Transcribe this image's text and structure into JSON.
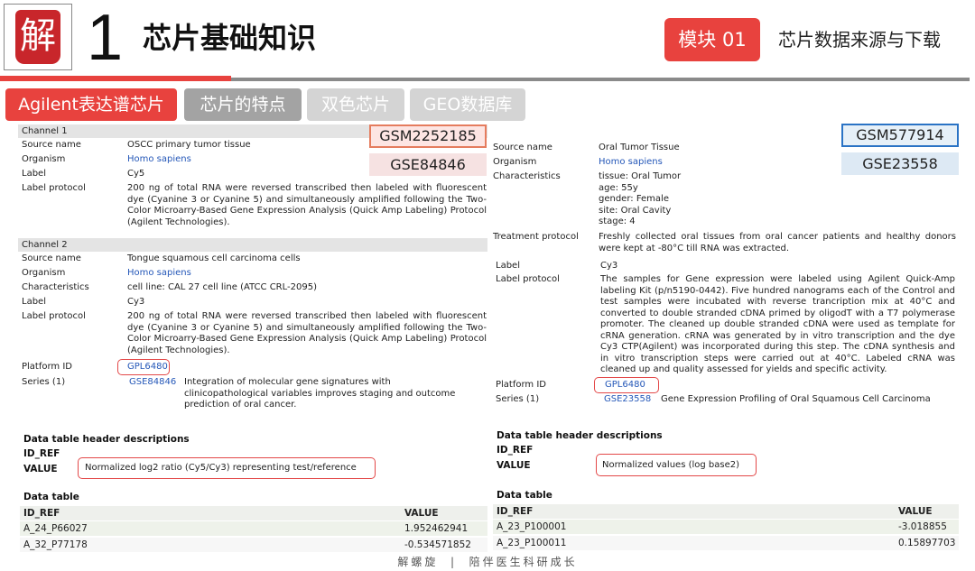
{
  "header": {
    "logo_char": "解",
    "number": "1",
    "title": "芯片基础知识",
    "module_badge": "模块 01",
    "module_title": "芯片数据来源与下载"
  },
  "tabs": [
    {
      "label": "Agilent表达谱芯片",
      "active": true
    },
    {
      "label": "芯片的特点",
      "active": false
    },
    {
      "label": "双色芯片",
      "active": false
    },
    {
      "label": "GEO数据库",
      "active": false
    }
  ],
  "left": {
    "channel1": {
      "heading": "Channel 1",
      "source_label": "Source name",
      "source": "OSCC primary tumor tissue",
      "organism_label": "Organism",
      "organism": "Homo sapiens",
      "label_label": "Label",
      "label": "Cy5",
      "protocol_label": "Label protocol",
      "protocol": "200 ng of total RNA were reversed transcribed then labeled with fluorescent dye (Cyanine 3 or Cyanine 5) and simultaneously amplified following the Two-Color Microarry-Based Gene Expression Analysis (Quick Amp Labeling) Protocol (Agilent Technologies)."
    },
    "channel2": {
      "heading": "Channel 2",
      "source_label": "Source name",
      "source": "Tongue squamous cell carcinoma cells",
      "organism_label": "Organism",
      "organism": "Homo sapiens",
      "char_label": "Characteristics",
      "characteristics": "cell line: CAL 27 cell line (ATCC CRL-2095)",
      "label_label": "Label",
      "label": "Cy3",
      "protocol_label": "Label protocol",
      "protocol": "200 ng of total RNA were reversed transcribed then labeled with fluorescent dye (Cyanine 3 or Cyanine 5) and simultaneously amplified following the Two-Color Microarry-Based Gene Expression Analysis (Quick Amp Labeling) Protocol (Agilent Technologies)."
    },
    "platform_label": "Platform ID",
    "platform": "GPL6480",
    "series_label": "Series (1)",
    "series_id": "GSE84846",
    "series_desc": "Integration of molecular gene signatures with clinicopathological variables improves staging and outcome prediction of oral cancer.",
    "callout_gsm": "GSM2252185",
    "callout_gse": "GSE84846",
    "desc_heading": "Data table header descriptions",
    "id_ref": "ID_REF",
    "value_label": "VALUE",
    "value_desc": "Normalized log2 ratio (Cy5/Cy3) representing test/reference",
    "table": {
      "heading": "Data table",
      "columns": [
        "ID_REF",
        "VALUE"
      ],
      "rows": [
        [
          "A_24_P66027",
          "1.952462941"
        ],
        [
          "A_32_P77178",
          "-0.534571852"
        ]
      ]
    }
  },
  "right": {
    "callout_gsm": "GSM577914",
    "callout_gse": "GSE23558",
    "source_label": "Source name",
    "source": "Oral Tumor Tissue",
    "organism_label": "Organism",
    "organism": "Homo sapiens",
    "char_label": "Characteristics",
    "characteristics": [
      "tissue: Oral Tumor",
      "age: 55y",
      "gender: Female",
      "site: Oral Cavity",
      "stage: 4"
    ],
    "treatment_label": "Treatment protocol",
    "treatment": "Freshly collected oral tissues from oral cancer patients and healthy donors were kept at -80°C till RNA was extracted.",
    "label_label": "Label",
    "label": "Cy3",
    "protocol_label": "Label protocol",
    "protocol": "The samples for Gene expression were labeled using Agilent Quick-Amp labeling Kit (p/n5190-0442). Five hundred nanograms each of the Control and test samples were incubated with reverse trancription mix at 40°C and converted to double stranded cDNA primed by oligodT with a T7 polymerase promoter. The cleaned up double stranded cDNA were used as template for cRNA generation. cRNA was generated by in vitro transcription and the dye Cy3 CTP(Agilent) was incorporated during this step. The cDNA synthesis and in vitro transcription steps were carried out at 40°C. Labeled cRNA was cleaned up and quality assessed for yields and specific activity.",
    "platform_label": "Platform ID",
    "platform": "GPL6480",
    "series_label": "Series (1)",
    "series_id": "GSE23558",
    "series_desc": "Gene Expression Profiling of Oral Squamous Cell Carcinoma",
    "desc_heading": "Data table header descriptions",
    "id_ref": "ID_REF",
    "value_label": "VALUE",
    "value_desc": "Normalized values (log base2)",
    "table": {
      "heading": "Data table",
      "columns": [
        "ID_REF",
        "VALUE"
      ],
      "rows": [
        [
          "A_23_P100001",
          "-3.018855"
        ],
        [
          "A_23_P100011",
          "0.15897703"
        ]
      ]
    }
  },
  "footer": "解螺旋  |  陪伴医生科研成长",
  "colors": {
    "accent": "#e8423e",
    "link": "#2457b8",
    "blue_box": "#2a73c5"
  }
}
